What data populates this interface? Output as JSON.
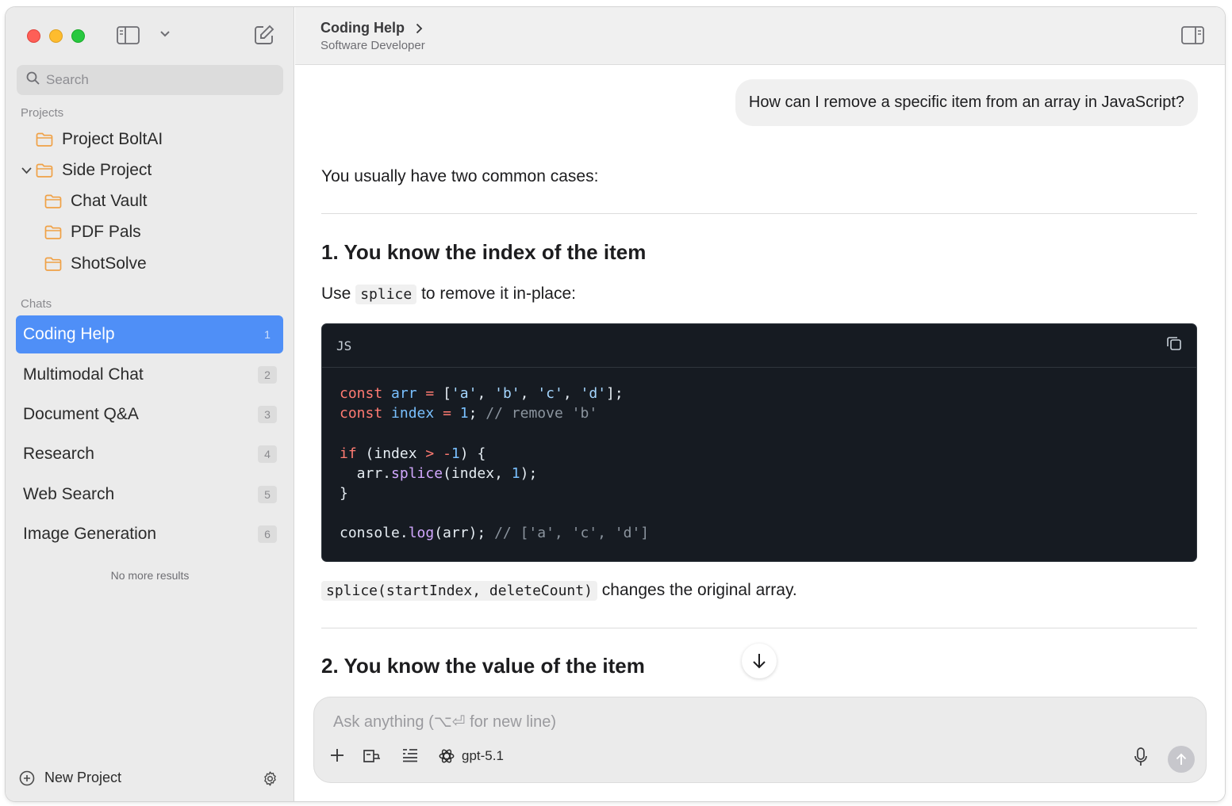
{
  "sidebar": {
    "search_placeholder": "Search",
    "projects_label": "Projects",
    "projects": [
      {
        "label": "Project BoltAI"
      },
      {
        "label": "Side Project",
        "expanded": true
      },
      {
        "label": "Chat Vault"
      },
      {
        "label": "PDF Pals"
      },
      {
        "label": "ShotSolve"
      }
    ],
    "chats_label": "Chats",
    "chats": [
      {
        "label": "Coding Help",
        "badge": "1",
        "active": true
      },
      {
        "label": "Multimodal Chat",
        "badge": "2"
      },
      {
        "label": "Document Q&A",
        "badge": "3"
      },
      {
        "label": "Research",
        "badge": "4"
      },
      {
        "label": "Web Search",
        "badge": "5"
      },
      {
        "label": "Image Generation",
        "badge": "6"
      }
    ],
    "no_more_results": "No more results",
    "new_project_label": "New Project"
  },
  "header": {
    "title": "Coding Help",
    "subtitle": "Software Developer"
  },
  "conversation": {
    "user_message": "How can I remove a specific item from an array in JavaScript?",
    "intro": "You usually have two common cases:",
    "heading_1": "1. You know the index of the item",
    "use_prefix": "Use",
    "use_code": "splice",
    "use_suffix": "to remove it in-place:",
    "code_lang": "JS",
    "splice_code": "splice(startIndex, deleteCount)",
    "splice_note": "changes the original array.",
    "heading_2": "2. You know the value of the item"
  },
  "composer": {
    "placeholder": "Ask anything (⌥⏎ for new line)",
    "model": "gpt-5.1"
  },
  "colors": {
    "accent": "#4f8ff7",
    "sidebar_bg": "#ebebeb",
    "code_bg": "#161b22",
    "folder": "#f0a146"
  }
}
